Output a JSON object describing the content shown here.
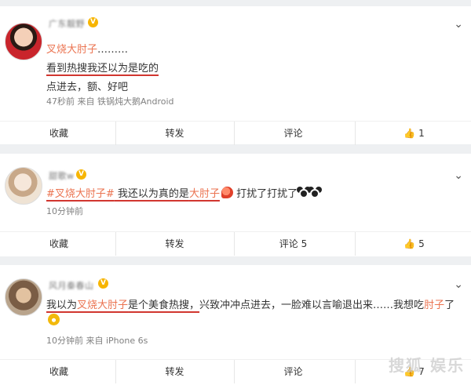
{
  "posts": [
    {
      "username": "广东靓野",
      "hashtag": "叉烧大肘子",
      "hashtag_suffix": "………",
      "line2": "看到热搜我还以为是吃的",
      "line3": "点进去，额、好吧",
      "meta": "47秒前 来自 铁锅炖大鹅Android",
      "actions": {
        "favorite": "收藏",
        "repost": "转发",
        "comment": "评论",
        "like": "1"
      }
    },
    {
      "username": "甜歌w",
      "text_prefix": "#叉烧大肘子#",
      "text_mid": " 我还以为真的是",
      "text_red": "大肘子",
      "text_suffix": " 打扰了打扰了",
      "meta": "10分钟前",
      "actions": {
        "favorite": "收藏",
        "repost": "转发",
        "comment": "评论 5",
        "like": "5"
      }
    },
    {
      "username": "风月秦春山",
      "text_a": "我以为",
      "text_b": "叉烧大肘子",
      "text_c": "是个美食热搜，",
      "text_d": "兴致冲冲点进去，一脸难以言喻退出来……我想吃",
      "text_e": "肘子",
      "text_f": "了",
      "meta": "10分钟前 来自 iPhone 6s",
      "actions": {
        "favorite": "收藏",
        "repost": "转发",
        "comment": "评论",
        "like": "7"
      }
    }
  ],
  "watermark": "搜狐 娱乐",
  "colors": {
    "accent": "#eb7350",
    "underline": "#d1362f",
    "vip": "#f7b500"
  }
}
